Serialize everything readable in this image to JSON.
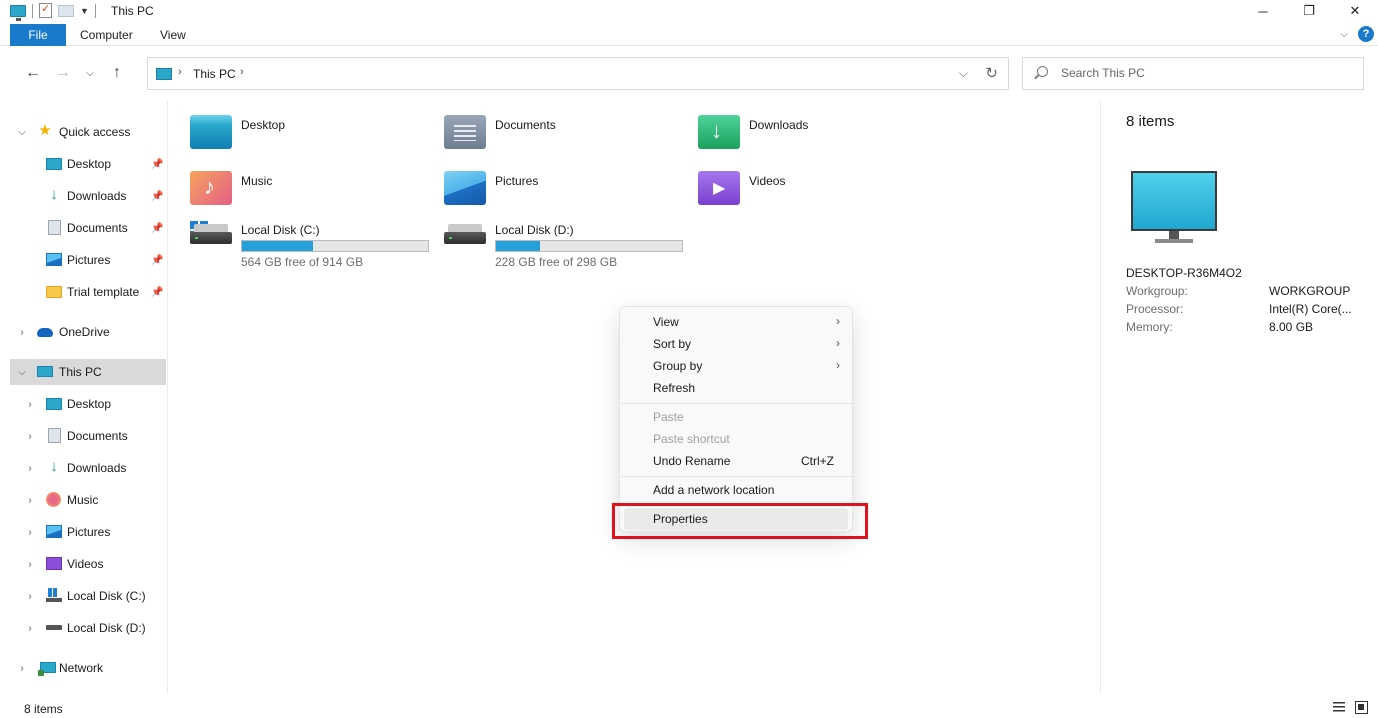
{
  "window": {
    "title": "This PC",
    "minimize_glyph": "─",
    "maximize_glyph": "❐",
    "close_glyph": "✕"
  },
  "ribbon": {
    "tabs": [
      {
        "label": "File",
        "active": true
      },
      {
        "label": "Computer"
      },
      {
        "label": "View"
      }
    ],
    "help_label": "?",
    "collapse_glyph": "⌵"
  },
  "nav": {
    "back_glyph": "←",
    "forward_glyph": "→",
    "recent_glyph": "⌵",
    "up_glyph": "↑",
    "address": {
      "path": "This PC",
      "separator": "›",
      "dropdown_glyph": "⌵",
      "refresh_glyph": "↻"
    },
    "search": {
      "placeholder": "Search This PC"
    }
  },
  "sidebar": {
    "chevron_expanded": "⌵",
    "chevron_collapsed": "›",
    "pin_glyph": "📌",
    "items": [
      {
        "label": "Quick access",
        "icon": "star-icon",
        "expanded": true
      },
      {
        "label": "Desktop",
        "icon": "desktop-icon",
        "pinned": true
      },
      {
        "label": "Downloads",
        "icon": "downloads-icon",
        "pinned": true
      },
      {
        "label": "Documents",
        "icon": "documents-icon",
        "pinned": true
      },
      {
        "label": "Pictures",
        "icon": "pictures-icon",
        "pinned": true
      },
      {
        "label": "Trial template",
        "icon": "folder-icon",
        "pinned": true
      },
      {
        "label": "OneDrive",
        "icon": "onedrive-icon"
      },
      {
        "label": "This PC",
        "icon": "this-pc-icon",
        "expanded": true,
        "selected": true
      },
      {
        "label": "Desktop",
        "icon": "desktop-icon"
      },
      {
        "label": "Documents",
        "icon": "documents-icon"
      },
      {
        "label": "Downloads",
        "icon": "downloads-icon"
      },
      {
        "label": "Music",
        "icon": "music-icon"
      },
      {
        "label": "Pictures",
        "icon": "pictures-icon"
      },
      {
        "label": "Videos",
        "icon": "videos-icon"
      },
      {
        "label": "Local Disk (C:)",
        "icon": "windows-disk-icon"
      },
      {
        "label": "Local Disk (D:)",
        "icon": "disk-icon"
      },
      {
        "label": "Network",
        "icon": "network-icon"
      }
    ]
  },
  "content": {
    "folders": [
      {
        "label": "Desktop",
        "icon": "desktop-folder-icon"
      },
      {
        "label": "Documents",
        "icon": "documents-folder-icon"
      },
      {
        "label": "Downloads",
        "icon": "downloads-folder-icon"
      },
      {
        "label": "Music",
        "icon": "music-folder-icon"
      },
      {
        "label": "Pictures",
        "icon": "pictures-folder-icon"
      },
      {
        "label": "Videos",
        "icon": "videos-folder-icon"
      }
    ],
    "drives": [
      {
        "label": "Local Disk (C:)",
        "free_text": "564 GB free of 914 GB",
        "used_fraction": 0.383,
        "icon": "windows-drive-icon"
      },
      {
        "label": "Local Disk (D:)",
        "free_text": "228 GB free of 298 GB",
        "used_fraction": 0.235,
        "icon": "drive-icon"
      }
    ],
    "bar_color": "#26a0da"
  },
  "details": {
    "item_count": "8 items",
    "pc_name": "DESKTOP-R36M4O2",
    "properties": [
      {
        "key": "Workgroup:",
        "value": "WORKGROUP"
      },
      {
        "key": "Processor:",
        "value": "Intel(R) Core(..."
      },
      {
        "key": "Memory:",
        "value": "8.00 GB"
      }
    ]
  },
  "context_menu": {
    "arrow_glyph": "›",
    "items": [
      {
        "label": "View",
        "submenu": true
      },
      {
        "label": "Sort by",
        "submenu": true
      },
      {
        "label": "Group by",
        "submenu": true
      },
      {
        "label": "Refresh"
      },
      {
        "label": "Paste",
        "disabled": true
      },
      {
        "label": "Paste shortcut",
        "disabled": true
      },
      {
        "label": "Undo Rename",
        "shortcut": "Ctrl+Z"
      },
      {
        "label": "Add a network location"
      },
      {
        "label": "Properties",
        "highlighted": true
      }
    ],
    "highlight_color": "#e0121d"
  },
  "status": {
    "text": "8 items"
  }
}
